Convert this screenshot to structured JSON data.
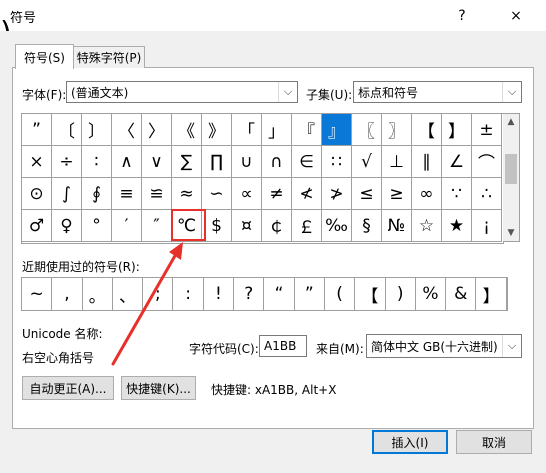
{
  "window": {
    "title": "符号",
    "help": "?",
    "close": "×",
    "background_fragment": ")"
  },
  "tabs": [
    {
      "label": "符号(S)",
      "active": true
    },
    {
      "label": "特殊字符(P)",
      "active": false
    }
  ],
  "font": {
    "label": "字体(F):",
    "value": "(普通文本)"
  },
  "subset": {
    "label": "子集(U):",
    "value": "标点和符号"
  },
  "symbol_grid": {
    "rows": [
      [
        "”",
        "〔",
        "〕",
        "〈",
        "〉",
        "《",
        "》",
        "「",
        "」",
        "『",
        "』",
        "〖",
        "〗",
        "【",
        "】",
        "±"
      ],
      [
        "×",
        "÷",
        "∶",
        "∧",
        "∨",
        "∑",
        "∏",
        "∪",
        "∩",
        "∈",
        "∷",
        "√",
        "⊥",
        "∥",
        "∠",
        "⌒"
      ],
      [
        "⊙",
        "∫",
        "∮",
        "≡",
        "≌",
        "≈",
        "∽",
        "∝",
        "≠",
        "≮",
        "≯",
        "≤",
        "≥",
        "∞",
        "∵",
        "∴"
      ],
      [
        "♂",
        "♀",
        "°",
        "′",
        "″",
        "℃",
        "$",
        "¤",
        "￠",
        "￡",
        "‰",
        "§",
        "№",
        "☆",
        "★",
        "¡"
      ]
    ],
    "selected": "』",
    "selected_color": "#0a78d7"
  },
  "recent": {
    "label": "近期使用过的符号(R):",
    "symbols": [
      "~",
      ",",
      "。",
      "、",
      ";",
      ":",
      "!",
      "?",
      "“",
      "”",
      "(",
      "【",
      ")",
      "%",
      "&",
      "】"
    ]
  },
  "unicode_name": {
    "label": "Unicode 名称:",
    "value": "右空心角括号"
  },
  "char_code": {
    "label": "字符代码(C):",
    "value": "A1BB"
  },
  "from": {
    "label": "来自(M):",
    "value": "简体中文 GB(十六进制)"
  },
  "buttons": {
    "autocorrect": "自动更正(A)...",
    "shortcut_key": "快捷键(K)...",
    "insert": "插入(I)",
    "cancel": "取消"
  },
  "shortcut_text": "快捷键: xA1BB, Alt+X",
  "annotation": {
    "target": "℃",
    "color": "#e8302a"
  },
  "icons": {
    "scroll_up": "chevron-up-icon",
    "scroll_down": "chevron-down-icon",
    "dropdown": "chevron-down-icon"
  }
}
